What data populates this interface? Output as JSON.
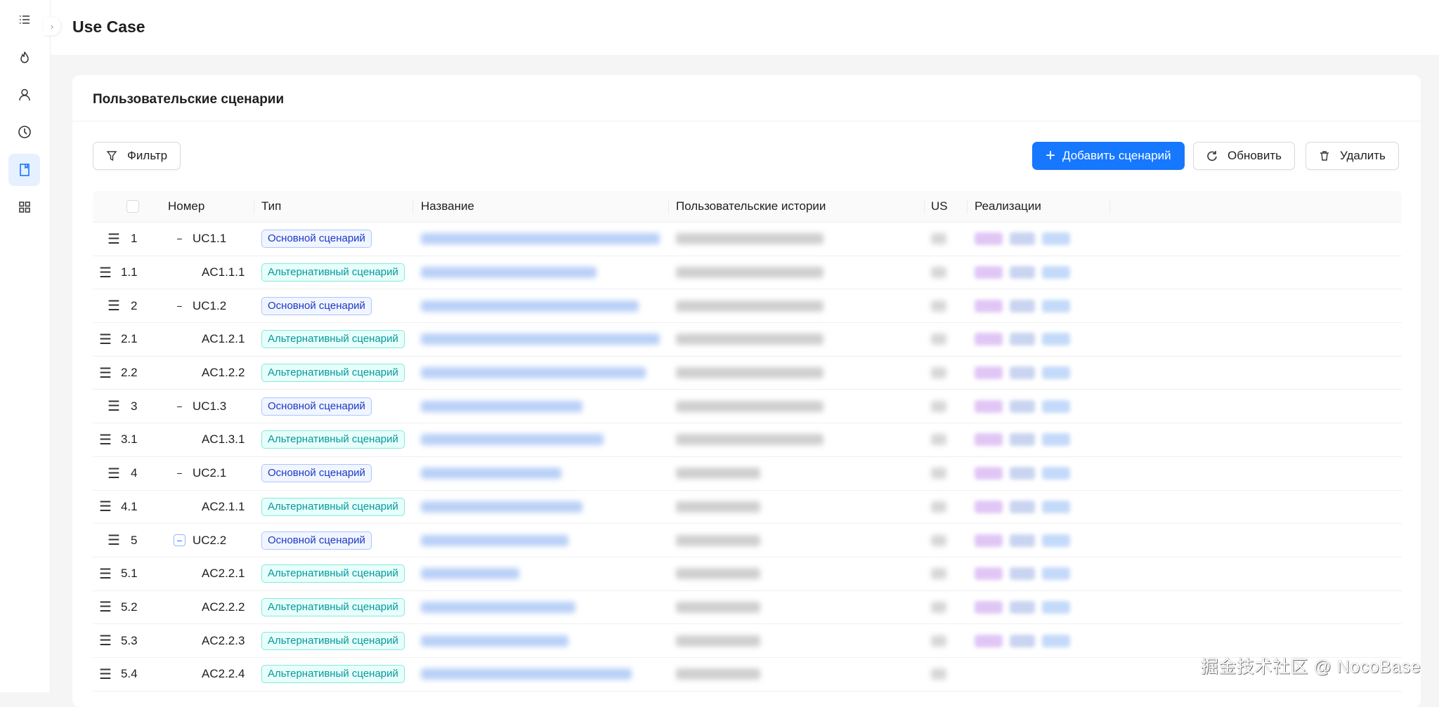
{
  "header": {
    "title": "Use Case"
  },
  "sidebar": {
    "items": [
      {
        "icon": "list-icon"
      },
      {
        "icon": "fire-icon"
      },
      {
        "icon": "user-icon"
      },
      {
        "icon": "clock-icon"
      },
      {
        "icon": "book-icon",
        "active": true
      },
      {
        "icon": "apps-icon"
      }
    ]
  },
  "card": {
    "title": "Пользовательские сценарии"
  },
  "toolbar": {
    "filter": "Фильтр",
    "add": "Добавить сценарий",
    "refresh": "Обновить",
    "delete": "Удалить"
  },
  "table": {
    "columns": [
      "Номер",
      "Тип",
      "Название",
      "Пользовательские истории",
      "US",
      "Реализации"
    ],
    "type_labels": {
      "main": "Основной сценарий",
      "alt": "Альтернативный сценарий"
    },
    "rows": [
      {
        "index": "1",
        "code": "UC1.1",
        "type": "main"
      },
      {
        "index": "1.1",
        "code": "AC1.1.1",
        "type": "alt"
      },
      {
        "index": "2",
        "code": "UC1.2",
        "type": "main"
      },
      {
        "index": "2.1",
        "code": "AC1.2.1",
        "type": "alt"
      },
      {
        "index": "2.2",
        "code": "AC1.2.2",
        "type": "alt"
      },
      {
        "index": "3",
        "code": "UC1.3",
        "type": "main"
      },
      {
        "index": "3.1",
        "code": "AC1.3.1",
        "type": "alt"
      },
      {
        "index": "4",
        "code": "UC2.1",
        "type": "main"
      },
      {
        "index": "4.1",
        "code": "AC2.1.1",
        "type": "alt"
      },
      {
        "index": "5",
        "code": "UC2.2",
        "type": "main"
      },
      {
        "index": "5.1",
        "code": "AC2.2.1",
        "type": "alt"
      },
      {
        "index": "5.2",
        "code": "AC2.2.2",
        "type": "alt"
      },
      {
        "index": "5.3",
        "code": "AC2.2.3",
        "type": "alt"
      },
      {
        "index": "5.4",
        "code": "AC2.2.4",
        "type": "alt"
      }
    ]
  },
  "watermark": "掘金技术社区 @ NocoBase",
  "colors": {
    "primary": "#1677ff",
    "main_tag": "#1d39c4",
    "alt_tag": "#08979c"
  }
}
